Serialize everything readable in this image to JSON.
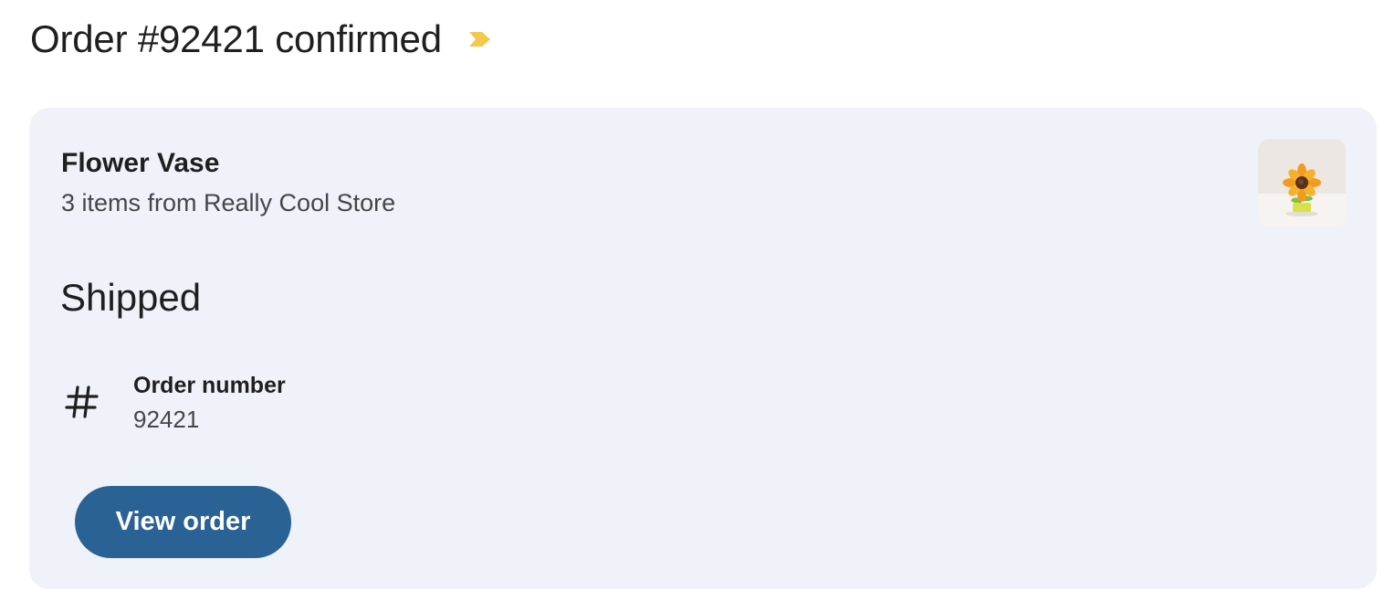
{
  "email": {
    "subject": "Order #92421 confirmed",
    "importance_icon": "importance-marker-icon",
    "importance_color": "#f2c94c"
  },
  "order_card": {
    "product_name": "Flower Vase",
    "product_subtitle": "3 items from Really Cool Store",
    "product_image_icon": "sunflower-product-thumbnail",
    "status": "Shipped",
    "detail_icon": "hash-icon",
    "detail_label": "Order number",
    "detail_value": "92421",
    "button_label": "View order",
    "button_color": "#2b6295",
    "card_background": "#eff3f9"
  }
}
